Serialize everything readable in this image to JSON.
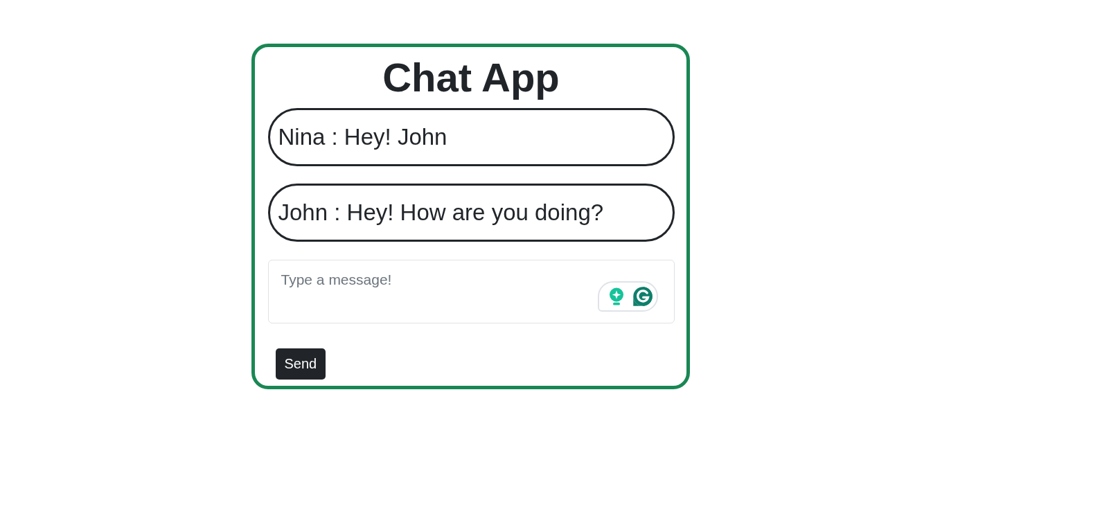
{
  "title": "Chat App",
  "messages": [
    {
      "text": "Nina : Hey! John"
    },
    {
      "text": "John : Hey! How are you doing?"
    }
  ],
  "composer": {
    "placeholder": "Type a message!"
  },
  "send_button": "Send"
}
